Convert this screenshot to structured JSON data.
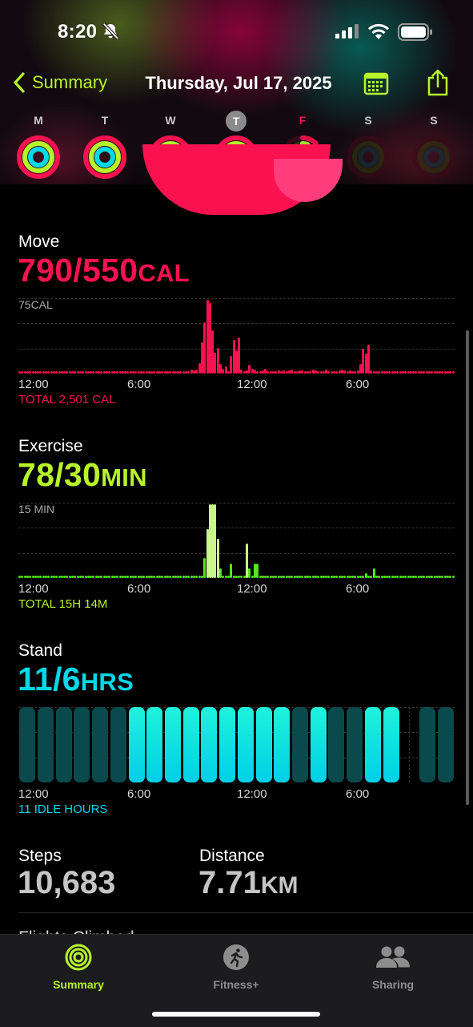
{
  "status_bar": {
    "time": "8:20"
  },
  "nav": {
    "back_label": "Summary",
    "title": "Thursday, Jul 17, 2025"
  },
  "week": [
    {
      "label": "M",
      "move": 1.0,
      "exercise": 1.0,
      "stand": 1.0
    },
    {
      "label": "T",
      "move": 1.0,
      "exercise": 1.0,
      "stand": 1.0
    },
    {
      "label": "W",
      "move": 1.0,
      "exercise": 1.0,
      "stand": 1.0
    },
    {
      "label": "T",
      "move": 1.0,
      "exercise": 1.0,
      "stand": 1.0,
      "today": true
    },
    {
      "label": "F",
      "move": 0.12,
      "exercise": 0.06,
      "stand": 0.55,
      "partial": true
    },
    {
      "label": "S",
      "move": 0,
      "exercise": 0,
      "stand": 0
    },
    {
      "label": "S",
      "move": 0,
      "exercise": 0,
      "stand": 0
    }
  ],
  "colors": {
    "move": "#fa114f",
    "exercise": "#b7f42a",
    "stand": "#00d8e8",
    "accent": "#b7f42a"
  },
  "move": {
    "title": "Move",
    "value": "790/550",
    "unit": "CAL",
    "y_label": "75CAL",
    "x_labels": [
      "12:00",
      "6:00",
      "12:00",
      "6:00"
    ],
    "total": "TOTAL 2,501 CAL",
    "chart_data": {
      "type": "bar",
      "ymax": 75,
      "values": [
        1,
        1,
        1,
        1,
        1,
        1,
        1,
        1,
        1,
        1,
        1,
        1,
        1,
        1,
        1,
        1,
        1,
        1,
        1,
        1,
        1,
        1,
        1,
        1,
        1,
        1,
        1,
        1,
        1,
        1,
        1,
        1,
        1,
        1,
        1,
        1,
        1,
        1,
        1,
        1,
        1,
        1,
        1,
        1,
        1,
        1,
        1,
        1,
        1,
        1,
        1,
        2,
        1,
        1,
        2,
        1,
        1,
        1,
        2,
        1,
        2,
        2,
        1,
        1,
        1,
        4,
        3,
        4,
        11,
        32,
        52,
        75,
        72,
        44,
        21,
        26,
        10,
        5,
        7,
        1,
        18,
        34,
        24,
        37,
        4,
        1,
        3,
        9,
        5,
        4,
        2,
        1,
        3,
        5,
        1,
        2,
        2,
        1,
        3,
        1,
        3,
        1,
        3,
        4,
        2,
        2,
        3,
        3,
        1,
        1,
        2,
        4,
        3,
        2,
        2,
        2,
        4,
        2,
        2,
        2,
        2,
        3,
        4,
        3,
        2,
        3,
        2,
        2,
        3,
        10,
        25,
        20,
        29,
        3,
        1,
        1,
        1,
        1,
        1,
        1,
        1,
        1,
        1,
        1,
        1,
        1,
        1,
        1,
        1,
        1,
        1,
        1,
        1,
        1,
        1,
        1,
        1,
        1,
        1,
        1,
        1,
        1,
        1,
        1,
        1
      ]
    }
  },
  "exercise": {
    "title": "Exercise",
    "value": "78/30",
    "unit": "MIN",
    "y_label": "15 MIN",
    "x_labels": [
      "12:00",
      "6:00",
      "12:00",
      "6:00"
    ],
    "total": "TOTAL 15H 14M",
    "chart_data": {
      "type": "bar",
      "ymax": 15,
      "values": [
        0,
        0,
        0,
        0,
        0,
        0,
        0,
        0,
        0,
        0,
        0,
        0,
        0,
        0,
        0,
        0,
        0,
        0,
        0,
        0,
        0,
        0,
        0,
        0,
        0,
        0,
        0,
        0,
        0,
        0,
        0,
        0,
        0,
        0,
        0,
        0,
        0,
        0,
        0,
        0,
        0,
        0,
        0,
        0,
        0,
        0,
        0,
        0,
        0,
        0,
        0,
        0,
        0,
        0,
        0,
        0,
        0,
        0,
        0,
        0,
        0,
        0,
        0,
        0,
        0,
        0,
        0,
        0,
        0,
        0,
        4,
        10,
        15,
        15,
        15,
        8,
        2,
        0,
        0,
        0,
        3,
        0,
        0,
        0,
        0,
        0,
        7,
        2,
        0,
        3,
        3,
        0,
        0,
        0,
        0,
        0,
        0,
        0,
        0,
        0,
        0,
        0,
        0,
        0,
        0,
        0,
        0,
        0,
        0,
        0,
        0,
        0,
        0,
        0,
        0,
        0,
        0,
        0,
        0,
        0,
        0,
        0,
        0,
        0,
        0,
        0,
        0,
        0,
        0,
        0,
        0,
        1,
        0,
        0,
        2,
        0,
        0,
        0,
        0,
        0,
        0,
        0,
        0,
        0,
        0,
        0,
        0,
        0,
        0,
        0,
        0,
        0,
        0,
        0,
        0,
        0,
        0,
        0,
        0,
        0,
        0,
        0,
        0,
        0,
        0
      ]
    }
  },
  "stand": {
    "title": "Stand",
    "value": "11/6",
    "unit": "HRS",
    "x_labels": [
      "12:00",
      "6:00",
      "12:00",
      "6:00"
    ],
    "total": "11 IDLE HOURS",
    "chart_data": {
      "type": "bar",
      "hours": [
        "idle",
        "idle",
        "idle",
        "idle",
        "idle",
        "idle",
        "stood",
        "stood",
        "stood",
        "stood",
        "stood",
        "stood",
        "stood",
        "stood",
        "stood",
        "idle",
        "stood",
        "idle",
        "idle",
        "stood",
        "stood",
        "none",
        "idle",
        "idle"
      ]
    }
  },
  "stats": {
    "steps_label": "Steps",
    "steps_value": "10,683",
    "distance_label": "Distance",
    "distance_value": "7.71",
    "distance_unit": "KM",
    "next_label": "Flights Climbed"
  },
  "tabs": [
    {
      "label": "Summary",
      "icon": "activity-rings-icon",
      "active": true
    },
    {
      "label": "Fitness+",
      "icon": "fitness-runner-icon",
      "active": false
    },
    {
      "label": "Sharing",
      "icon": "sharing-people-icon",
      "active": false
    }
  ]
}
